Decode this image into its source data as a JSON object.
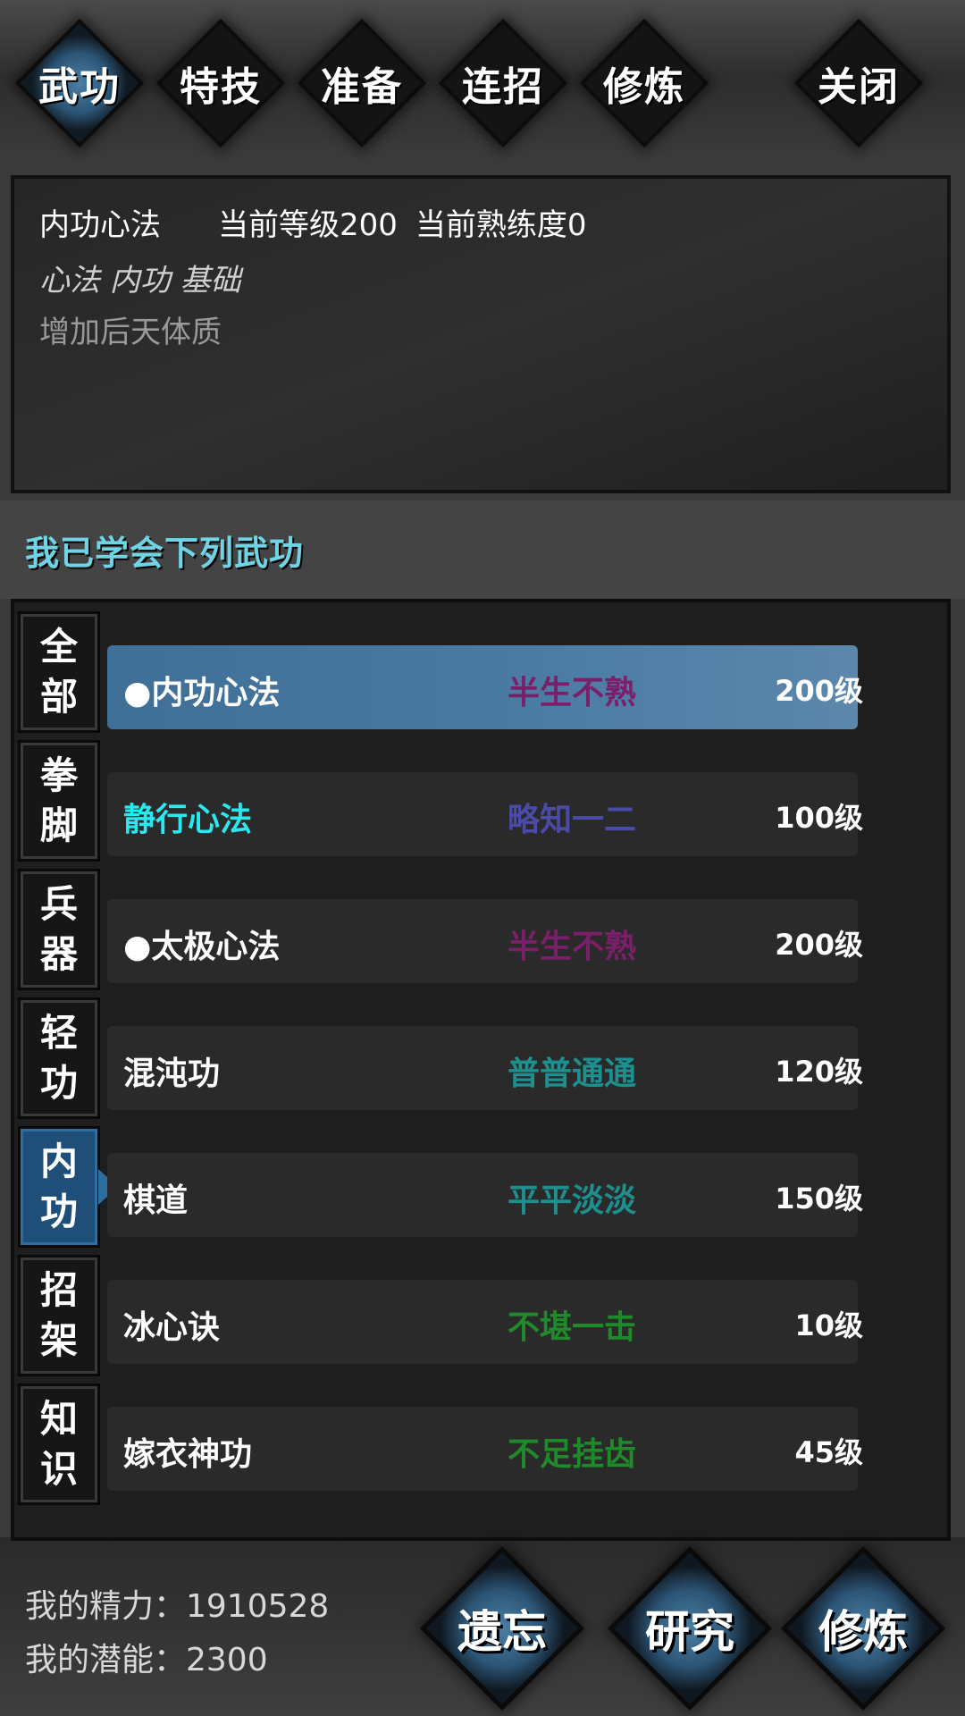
{
  "top_tabs": [
    "武功",
    "特技",
    "准备",
    "连招",
    "修炼",
    "关闭"
  ],
  "info": {
    "name": "内功心法",
    "level_text": "当前等级200",
    "proficiency_text": "当前熟练度0",
    "tags": "心法 内功 基础",
    "description": "增加后天体质"
  },
  "learned_title": "我已学会下列武功",
  "categories": [
    {
      "line1": "全",
      "line2": "部"
    },
    {
      "line1": "拳",
      "line2": "脚"
    },
    {
      "line1": "兵",
      "line2": "器"
    },
    {
      "line1": "轻",
      "line2": "功"
    },
    {
      "line1": "内",
      "line2": "功"
    },
    {
      "line1": "招",
      "line2": "架"
    },
    {
      "line1": "知",
      "line2": "识"
    }
  ],
  "skills": [
    {
      "name": "●内功心法",
      "proficiency": "半生不熟",
      "level": "200级",
      "prof_color": "#7a1f6a",
      "name_color": "#ffffff"
    },
    {
      "name": "静行心法",
      "proficiency": "略知一二",
      "level": "100级",
      "prof_color": "#4a4aa8",
      "name_color": "#29e8ef"
    },
    {
      "name": "●太极心法",
      "proficiency": "半生不熟",
      "level": "200级",
      "prof_color": "#7a1f6a",
      "name_color": "#ffffff"
    },
    {
      "name": "混沌功",
      "proficiency": "普普通通",
      "level": "120级",
      "prof_color": "#1e8f8f",
      "name_color": "#ffffff"
    },
    {
      "name": "棋道",
      "proficiency": "平平淡淡",
      "level": "150级",
      "prof_color": "#1e8f8f",
      "name_color": "#ffffff"
    },
    {
      "name": "冰心诀",
      "proficiency": "不堪一击",
      "level": "10级",
      "prof_color": "#1f8a2a",
      "name_color": "#ffffff"
    },
    {
      "name": "嫁衣神功",
      "proficiency": "不足挂齿",
      "level": "45级",
      "prof_color": "#1f8a2a",
      "name_color": "#ffffff"
    }
  ],
  "stats": {
    "energy": "我的精力：1910528",
    "potential": "我的潜能：2300"
  },
  "bottom_buttons": [
    "遗忘",
    "研究",
    "修炼"
  ]
}
